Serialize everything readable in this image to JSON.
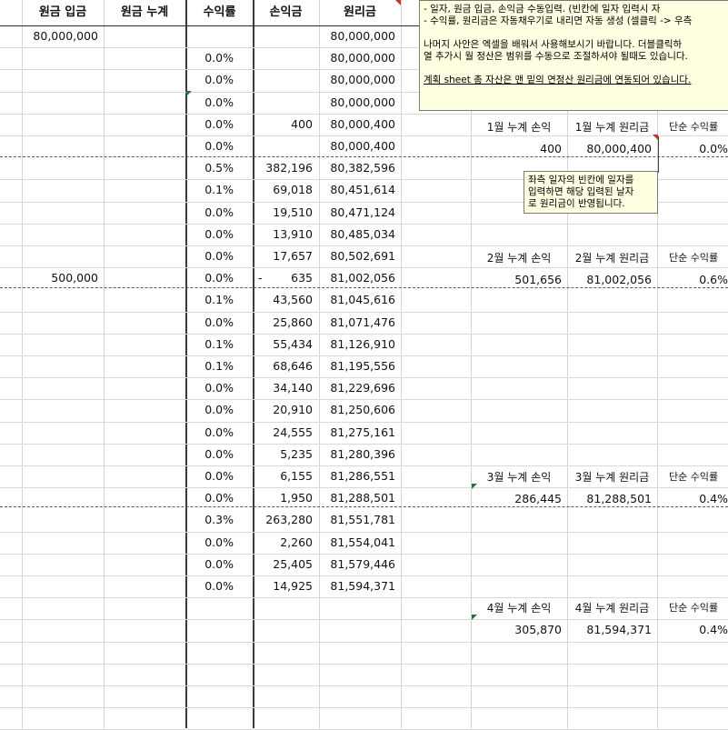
{
  "headers": {
    "deposit": "원금 입금",
    "cumulative": "원금 누계",
    "rate": "수익률",
    "profit": "손익금",
    "total": "원리금"
  },
  "rows": [
    {
      "deposit": "80,000,000",
      "rate": "",
      "profit": "",
      "total": "80,000,000"
    },
    {
      "deposit": "",
      "rate": "0.0%",
      "profit": "",
      "total": "80,000,000"
    },
    {
      "deposit": "",
      "rate": "0.0%",
      "profit": "",
      "total": "80,000,000"
    },
    {
      "deposit": "",
      "rate": "0.0%",
      "profit": "",
      "total": "80,000,000"
    },
    {
      "deposit": "",
      "rate": "0.0%",
      "profit": "400",
      "total": "80,000,400"
    },
    {
      "deposit": "",
      "rate": "0.0%",
      "profit": "",
      "total": "80,000,400"
    },
    {
      "deposit": "",
      "rate": "0.5%",
      "profit": "382,196",
      "total": "80,382,596"
    },
    {
      "deposit": "",
      "rate": "0.1%",
      "profit": "69,018",
      "total": "80,451,614"
    },
    {
      "deposit": "",
      "rate": "0.0%",
      "profit": "19,510",
      "total": "80,471,124"
    },
    {
      "deposit": "",
      "rate": "0.0%",
      "profit": "13,910",
      "total": "80,485,034"
    },
    {
      "deposit": "",
      "rate": "0.0%",
      "profit": "17,657",
      "total": "80,502,691"
    },
    {
      "deposit": "500,000",
      "rate": "0.0%",
      "profit_sign": "-",
      "profit": "635",
      "total": "81,002,056"
    },
    {
      "deposit": "",
      "rate": "0.1%",
      "profit": "43,560",
      "total": "81,045,616"
    },
    {
      "deposit": "",
      "rate": "0.0%",
      "profit": "25,860",
      "total": "81,071,476"
    },
    {
      "deposit": "",
      "rate": "0.1%",
      "profit": "55,434",
      "total": "81,126,910"
    },
    {
      "deposit": "",
      "rate": "0.1%",
      "profit": "68,646",
      "total": "81,195,556"
    },
    {
      "deposit": "",
      "rate": "0.0%",
      "profit": "34,140",
      "total": "81,229,696"
    },
    {
      "deposit": "",
      "rate": "0.0%",
      "profit": "20,910",
      "total": "81,250,606"
    },
    {
      "deposit": "",
      "rate": "0.0%",
      "profit": "24,555",
      "total": "81,275,161"
    },
    {
      "deposit": "",
      "rate": "0.0%",
      "profit": "5,235",
      "total": "81,280,396"
    },
    {
      "deposit": "",
      "rate": "0.0%",
      "profit": "6,155",
      "total": "81,286,551"
    },
    {
      "deposit": "",
      "rate": "0.0%",
      "profit": "1,950",
      "total": "81,288,501"
    },
    {
      "deposit": "",
      "rate": "0.3%",
      "profit": "263,280",
      "total": "81,551,781"
    },
    {
      "deposit": "",
      "rate": "0.0%",
      "profit": "2,260",
      "total": "81,554,041"
    },
    {
      "deposit": "",
      "rate": "0.0%",
      "profit": "25,405",
      "total": "81,579,446"
    },
    {
      "deposit": "",
      "rate": "0.0%",
      "profit": "14,925",
      "total": "81,594,371"
    }
  ],
  "monthly": [
    {
      "label_profit": "1월 누계 손익",
      "label_total": "1월 누계 원리금",
      "label_rate": "단순 수익률",
      "profit": "400",
      "total": "80,000,400",
      "rate": "0.0%"
    },
    {
      "label_profit": "2월 누계 손익",
      "label_total": "2월 누계 원리금",
      "label_rate": "단순 수익률",
      "profit": "501,656",
      "total": "81,002,056",
      "rate": "0.6%"
    },
    {
      "label_profit": "3월 누계 손익",
      "label_total": "3월 누계 원리금",
      "label_rate": "단순 수익률",
      "profit": "286,445",
      "total": "81,288,501",
      "rate": "0.4%"
    },
    {
      "label_profit": "4월 누계 손익",
      "label_total": "4월 누계 원리금",
      "label_rate": "단순 수익률",
      "profit": "305,870",
      "total": "81,594,371",
      "rate": "0.4%"
    }
  ],
  "note_main": {
    "line1": "- 일자, 원금 입금, 손익금 수동입력.            (빈칸에 일자 입력시 자",
    "line2": "- 수익률, 원리금은 자동채우기로 내리면 자동 생성 (셀클릭 -> 우측",
    "line3": "나머지 사안은 엑셀을 배워서 사용해보시기 바랍니다.  더블클릭하",
    "line4": "열 추가시 월 정산은 범위를 수동으로 조절하셔야 될때도 있습니다.",
    "line5": "계획 sheet 총 자산은 맨 밑의 연정산 원리금에 연동되어 있습니다."
  },
  "note_small": {
    "line1": "좌측 일자의 빈칸에 일자를",
    "line2": "입력하면 해당 입력된 날자",
    "line3": "로 원리금이 반영됩니다."
  },
  "colors": {
    "note_bg": "#ffffe1",
    "comment_marker": "#c0392b",
    "error_marker": "#1f7a3a"
  }
}
